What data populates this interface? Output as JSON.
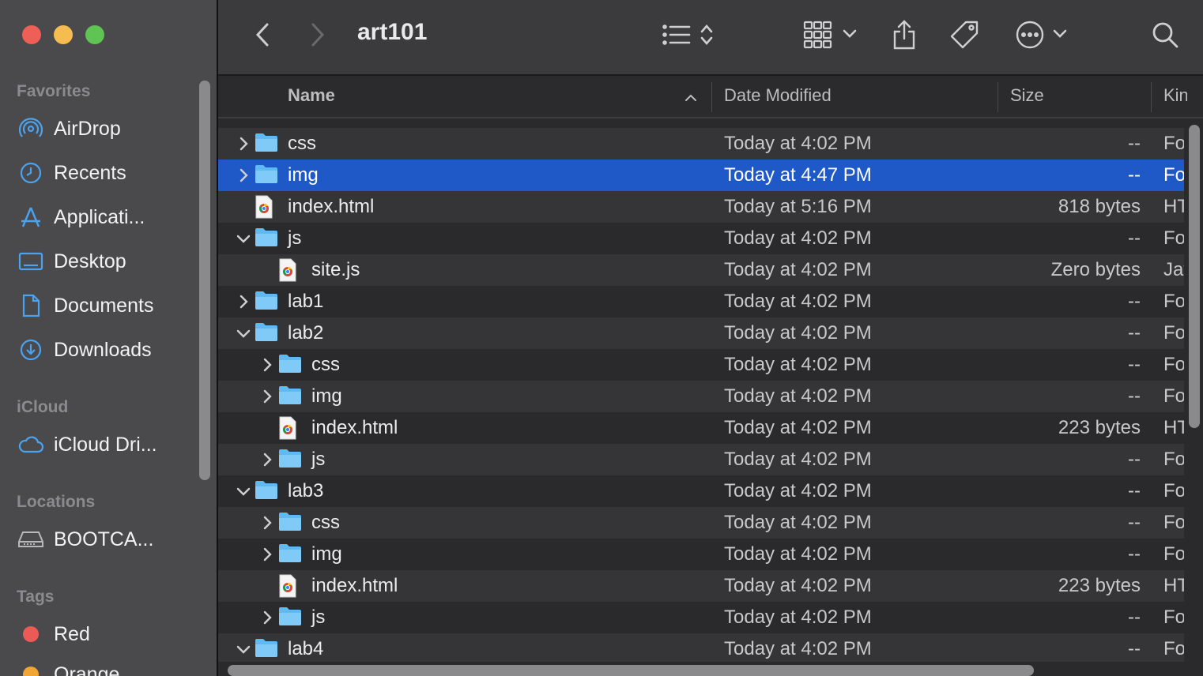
{
  "window": {
    "title": "art101"
  },
  "toolbar": {
    "back_icon": "chevron-left-icon",
    "forward_icon": "chevron-right-icon",
    "list_view_icon": "list-icon",
    "sort_icon": "up-down-chevron-icon",
    "group_icon": "grid-icon",
    "share_icon": "share-icon",
    "tag_icon": "tag-icon",
    "more_icon": "ellipsis-circle-icon",
    "search_icon": "search-icon"
  },
  "sidebar": {
    "favorites_title": "Favorites",
    "favorites": [
      {
        "label": "AirDrop",
        "icon": "airdrop-icon"
      },
      {
        "label": "Recents",
        "icon": "clock-icon"
      },
      {
        "label": "Applicati...",
        "icon": "applications-icon"
      },
      {
        "label": "Desktop",
        "icon": "desktop-icon"
      },
      {
        "label": "Documents",
        "icon": "document-icon"
      },
      {
        "label": "Downloads",
        "icon": "download-icon"
      }
    ],
    "icloud_title": "iCloud",
    "icloud": [
      {
        "label": "iCloud Dri...",
        "icon": "cloud-icon"
      }
    ],
    "locations_title": "Locations",
    "locations": [
      {
        "label": "BOOTCA...",
        "icon": "drive-icon"
      }
    ],
    "tags_title": "Tags",
    "tags": [
      {
        "label": "Red",
        "color": "#ec5a55"
      },
      {
        "label": "Orange",
        "color": "#f0a534"
      }
    ]
  },
  "columns": {
    "name": "Name",
    "date": "Date Modified",
    "size": "Size",
    "kind": "Kind"
  },
  "accent": "#1f59c8",
  "folder_color": "#5fb9f2",
  "files": [
    {
      "name": "css",
      "date": "Today at 4:02 PM",
      "size": "--",
      "kind": "Folder",
      "type": "folder",
      "depth": 0,
      "expand": "collapsed",
      "selected": false
    },
    {
      "name": "img",
      "date": "Today at 4:47 PM",
      "size": "--",
      "kind": "Folder",
      "type": "folder",
      "depth": 0,
      "expand": "collapsed",
      "selected": true
    },
    {
      "name": "index.html",
      "date": "Today at 5:16 PM",
      "size": "818 bytes",
      "kind": "HTML",
      "type": "html",
      "depth": 0,
      "expand": "none",
      "selected": false
    },
    {
      "name": "js",
      "date": "Today at 4:02 PM",
      "size": "--",
      "kind": "Folder",
      "type": "folder",
      "depth": 0,
      "expand": "expanded",
      "selected": false
    },
    {
      "name": "site.js",
      "date": "Today at 4:02 PM",
      "size": "Zero bytes",
      "kind": "JavaScript",
      "type": "js",
      "depth": 1,
      "expand": "none",
      "selected": false
    },
    {
      "name": "lab1",
      "date": "Today at 4:02 PM",
      "size": "--",
      "kind": "Folder",
      "type": "folder",
      "depth": 0,
      "expand": "collapsed",
      "selected": false
    },
    {
      "name": "lab2",
      "date": "Today at 4:02 PM",
      "size": "--",
      "kind": "Folder",
      "type": "folder",
      "depth": 0,
      "expand": "expanded",
      "selected": false
    },
    {
      "name": "css",
      "date": "Today at 4:02 PM",
      "size": "--",
      "kind": "Folder",
      "type": "folder",
      "depth": 1,
      "expand": "collapsed",
      "selected": false
    },
    {
      "name": "img",
      "date": "Today at 4:02 PM",
      "size": "--",
      "kind": "Folder",
      "type": "folder",
      "depth": 1,
      "expand": "collapsed",
      "selected": false
    },
    {
      "name": "index.html",
      "date": "Today at 4:02 PM",
      "size": "223 bytes",
      "kind": "HTML",
      "type": "html",
      "depth": 1,
      "expand": "none",
      "selected": false
    },
    {
      "name": "js",
      "date": "Today at 4:02 PM",
      "size": "--",
      "kind": "Folder",
      "type": "folder",
      "depth": 1,
      "expand": "collapsed",
      "selected": false
    },
    {
      "name": "lab3",
      "date": "Today at 4:02 PM",
      "size": "--",
      "kind": "Folder",
      "type": "folder",
      "depth": 0,
      "expand": "expanded",
      "selected": false
    },
    {
      "name": "css",
      "date": "Today at 4:02 PM",
      "size": "--",
      "kind": "Folder",
      "type": "folder",
      "depth": 1,
      "expand": "collapsed",
      "selected": false
    },
    {
      "name": "img",
      "date": "Today at 4:02 PM",
      "size": "--",
      "kind": "Folder",
      "type": "folder",
      "depth": 1,
      "expand": "collapsed",
      "selected": false
    },
    {
      "name": "index.html",
      "date": "Today at 4:02 PM",
      "size": "223 bytes",
      "kind": "HTML",
      "type": "html",
      "depth": 1,
      "expand": "none",
      "selected": false
    },
    {
      "name": "js",
      "date": "Today at 4:02 PM",
      "size": "--",
      "kind": "Folder",
      "type": "folder",
      "depth": 1,
      "expand": "collapsed",
      "selected": false
    },
    {
      "name": "lab4",
      "date": "Today at 4:02 PM",
      "size": "--",
      "kind": "Folder",
      "type": "folder",
      "depth": 0,
      "expand": "expanded",
      "selected": false
    }
  ]
}
